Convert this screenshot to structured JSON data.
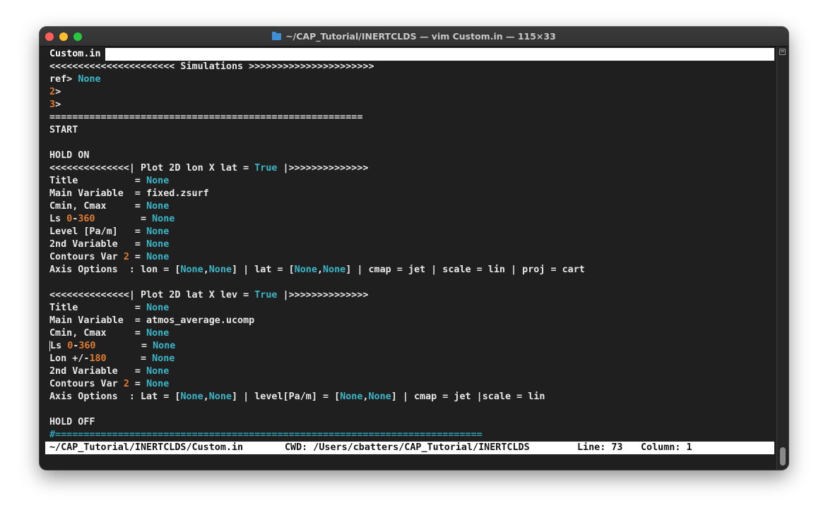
{
  "window": {
    "title": "~/CAP_Tutorial/INERTCLDS — vim Custom.in — 115×33"
  },
  "tab": {
    "label": "Custom.in"
  },
  "editor": {
    "sim_header": "<<<<<<<<<<<<<<<<<<<<<< Simulations >>>>>>>>>>>>>>>>>>>>>>",
    "ref_label": "ref> ",
    "ref_value": "None",
    "sim2_num": "2",
    "sim2_suffix": ">",
    "sim3_num": "3",
    "sim3_suffix": ">",
    "separator": "=======================================================",
    "start": "START",
    "hold_on": "HOLD ON",
    "block1": {
      "header_pre": "<<<<<<<<<<<<<<| Plot 2D lon X lat = ",
      "header_val": "True",
      "header_post": " |>>>>>>>>>>>>>>",
      "title_key": "Title          = ",
      "title_val": "None",
      "mainvar_line": "Main Variable  = fixed.zsurf",
      "cmin_key": "Cmin, Cmax     = ",
      "cmin_val": "None",
      "ls_key": "Ls ",
      "ls_n1": "0",
      "ls_dash": "-",
      "ls_n2": "360",
      "ls_eq": "        = ",
      "ls_val": "None",
      "level_key": "Level [Pa/m]   = ",
      "level_val": "None",
      "var2_key": "2nd Variable   = ",
      "var2_val": "None",
      "contours_key": "Contours Var ",
      "contours_num": "2",
      "contours_eq": " = ",
      "contours_val": "None",
      "axis_a": "Axis Options  : lon = [",
      "axis_v1": "None",
      "axis_comma1": ",",
      "axis_v2": "None",
      "axis_b": "] | lat = [",
      "axis_v3": "None",
      "axis_comma2": ",",
      "axis_v4": "None",
      "axis_c": "] | cmap = jet | scale = lin | proj = cart"
    },
    "block2": {
      "header_pre": "<<<<<<<<<<<<<<| Plot 2D lat X lev = ",
      "header_val": "True",
      "header_post": " |>>>>>>>>>>>>>>",
      "title_key": "Title          = ",
      "title_val": "None",
      "mainvar_line": "Main Variable  = atmos_average.ucomp",
      "cmin_key": "Cmin, Cmax     = ",
      "cmin_val": "None",
      "ls_key_l": "L",
      "ls_key_rest": "s ",
      "ls_n1": "0",
      "ls_dash": "-",
      "ls_n2": "360",
      "ls_eq": "        = ",
      "ls_val": "None",
      "lon_key": "Lon +/-",
      "lon_num": "180",
      "lon_eq": "      = ",
      "lon_val": "None",
      "var2_key": "2nd Variable   = ",
      "var2_val": "None",
      "contours_key": "Contours Var ",
      "contours_num": "2",
      "contours_eq": " = ",
      "contours_val": "None",
      "axis_a": "Axis Options  : Lat = [",
      "axis_v1": "None",
      "axis_comma1": ",",
      "axis_v2": "None",
      "axis_b": "] | level[Pa/m] = [",
      "axis_v3": "None",
      "axis_comma2": ",",
      "axis_v4": "None",
      "axis_c": "] | cmap = jet |scale = lin"
    },
    "hold_off": "HOLD OFF",
    "comment_line": "#==========================================================================="
  },
  "status": {
    "path": "~/CAP_Tutorial/INERTCLDS/Custom.in",
    "cwd": "CWD: /Users/cbatters/CAP_Tutorial/INERTCLDS",
    "line": "Line: 73",
    "column": "Column: 1"
  },
  "colors": {
    "keyword": "#3bb6c8",
    "number": "#e07b2f",
    "background": "#1f1f1f"
  }
}
